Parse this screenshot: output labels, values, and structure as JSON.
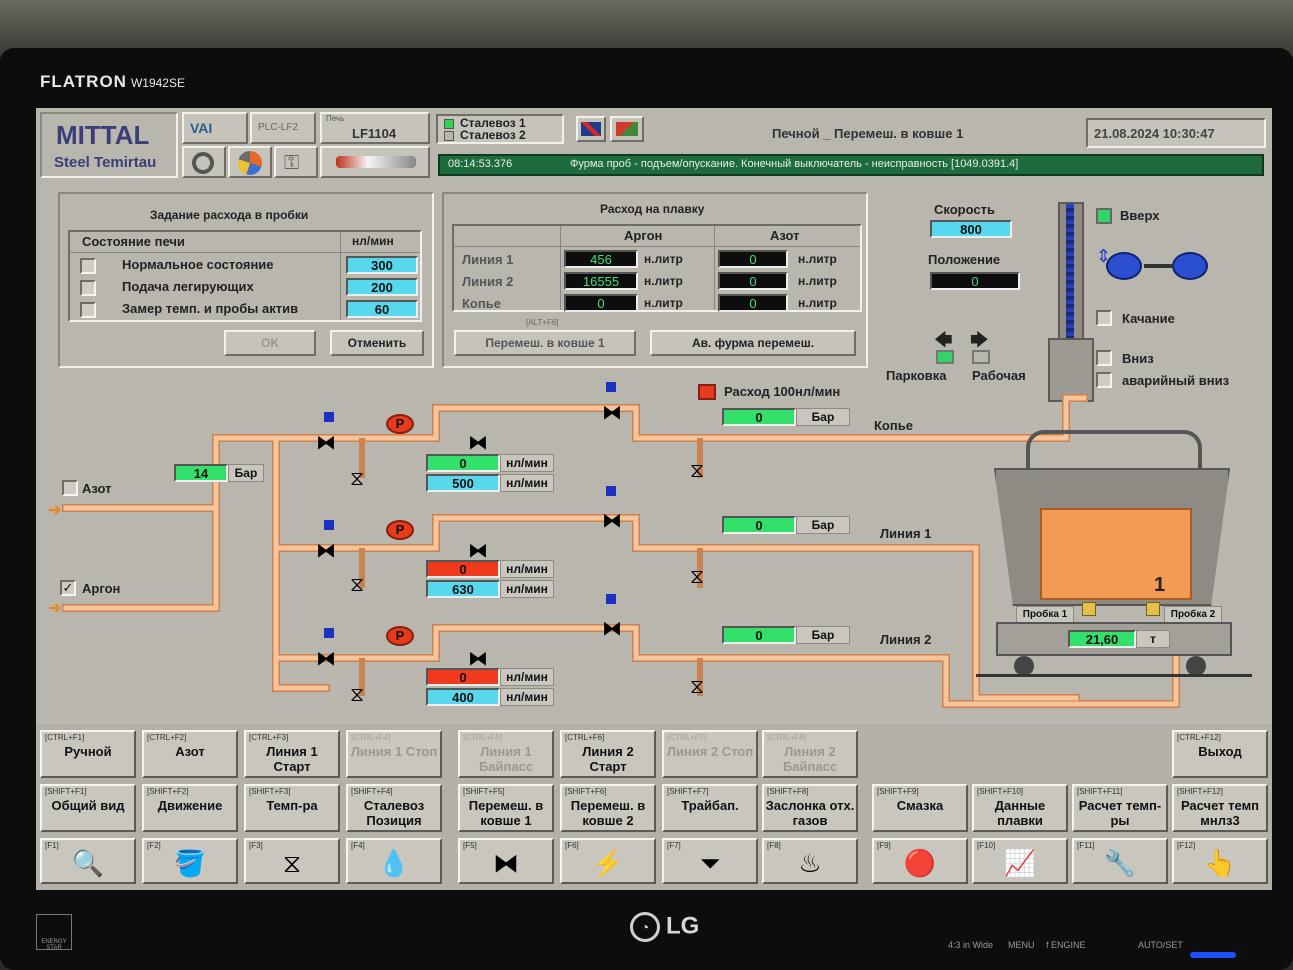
{
  "monitor": {
    "brand": "FLATRON",
    "model": "W1942SE",
    "maker": "LG",
    "buttons": [
      "4:3 in Wide",
      "MENU",
      "f ENGINE",
      "AUTO/SET"
    ]
  },
  "header": {
    "company": "MITTAL",
    "company_sub": "Steel Temirtau",
    "vai_label": "VAI",
    "plc_label": "PLC-LF2",
    "pech_label": "Печь",
    "unit_id": "LF1104",
    "steelcar1": "Сталевоз 1",
    "steelcar2": "Сталевоз 2",
    "mode": "Печной _ Перемеш. в ковше 1",
    "datetime": "21.08.2024 10:30:47",
    "alarm_time": "08:14:53.376",
    "alarm_text": "Фурма проб - подъем/опускание. Конечный выключатель - неисправность [1049.0391.4]"
  },
  "flow_task": {
    "title": "Задание расхода в пробки",
    "col_state": "Состояние печи",
    "col_unit": "нл/мин",
    "rows": [
      {
        "label": "Нормальное состояние",
        "value": "300"
      },
      {
        "label": "Подача легирующих",
        "value": "200"
      },
      {
        "label": "Замер темп. и пробы актив",
        "value": "60"
      }
    ],
    "ok": "OK",
    "cancel": "Отменить"
  },
  "consumption": {
    "title": "Расход на плавку",
    "col_argon": "Аргон",
    "col_nitrogen": "Азот",
    "unit": "н.литр",
    "rows": [
      {
        "label": "Линия 1",
        "argon": "456",
        "nitrogen": "0"
      },
      {
        "label": "Линия 2",
        "argon": "16555",
        "nitrogen": "0"
      },
      {
        "label": "Копье",
        "argon": "0",
        "nitrogen": "0"
      }
    ],
    "hotkey": "[ALT+F6]",
    "btn_stir": "Перемеш. в ковше 1",
    "btn_emergency": "Ав. фурма перемеш."
  },
  "lance": {
    "speed_label": "Скорость",
    "speed": "800",
    "position_label": "Положение",
    "position": "0",
    "up": "Вверх",
    "swing": "Качание",
    "down": "Вниз",
    "emergency_down": "аварийный вниз",
    "parking": "Парковка",
    "working": "Рабочая"
  },
  "process": {
    "nitrogen": "Азот",
    "argon": "Аргон",
    "inlet_pressure": "14",
    "bar": "Бар",
    "flow_unit": "нл/мин",
    "flow100": "Расход 100нл/мин",
    "lance_label": "Копье",
    "line1_label": "Линия 1",
    "line2_label": "Линия 2",
    "lance_pressure": "0",
    "line1_pressure": "0",
    "line2_pressure": "0",
    "lance_flow": "0",
    "lance_setpoint": "500",
    "line1_flow": "0",
    "line1_setpoint": "630",
    "line2_flow": "0",
    "line2_setpoint": "400",
    "p": "P",
    "plug1": "Пробка 1",
    "plug2": "Пробка 2",
    "ladle_no": "1",
    "weight": "21,60",
    "ton": "т"
  },
  "fkeys_row1": [
    {
      "key": "[CTRL+F1]",
      "label": "Ручной",
      "enabled": true
    },
    {
      "key": "[CTRL+F2]",
      "label": "Азот",
      "enabled": true
    },
    {
      "key": "[CTRL+F3]",
      "label": "Линия 1 Старт",
      "enabled": true
    },
    {
      "key": "[CTRL+F4]",
      "label": "Линия 1 Стоп",
      "enabled": false
    },
    {
      "key": "[CTRL+F5]",
      "label": "Линия 1 Байпасс",
      "enabled": false
    },
    {
      "key": "[CTRL+F6]",
      "label": "Линия 2 Старт",
      "enabled": true
    },
    {
      "key": "[CTRL+F7]",
      "label": "Линия 2 Стоп",
      "enabled": false
    },
    {
      "key": "[CTRL+F8]",
      "label": "Линия 2 Байпасс",
      "enabled": false
    },
    {
      "key": "[CTRL+F12]",
      "label": "Выход",
      "enabled": true
    }
  ],
  "fkeys_row2": [
    {
      "key": "[SHIFT+F1]",
      "label": "Общий вид"
    },
    {
      "key": "[SHIFT+F2]",
      "label": "Движение"
    },
    {
      "key": "[SHIFT+F3]",
      "label": "Темп-ра"
    },
    {
      "key": "[SHIFT+F4]",
      "label": "Сталевоз Позиция"
    },
    {
      "key": "[SHIFT+F5]",
      "label": "Перемеш. в ковше 1"
    },
    {
      "key": "[SHIFT+F6]",
      "label": "Перемеш. в ковше 2"
    },
    {
      "key": "[SHIFT+F7]",
      "label": "Трайбап."
    },
    {
      "key": "[SHIFT+F8]",
      "label": "Заслонка отх. газов"
    },
    {
      "key": "[SHIFT+F9]",
      "label": "Смазка"
    },
    {
      "key": "[SHIFT+F10]",
      "label": "Данные плавки"
    },
    {
      "key": "[SHIFT+F11]",
      "label": "Расчет темп-ры"
    },
    {
      "key": "[SHIFT+F12]",
      "label": "Расчет темп мнлз3"
    }
  ],
  "fkeys_row3": [
    {
      "key": "[F1]",
      "icon": "magnifier-icon",
      "glyph": "🔍"
    },
    {
      "key": "[F2]",
      "icon": "ladle-icon",
      "glyph": "🪣"
    },
    {
      "key": "[F3]",
      "icon": "valve-icon",
      "glyph": "⧖"
    },
    {
      "key": "[F4]",
      "icon": "drops-icon",
      "glyph": "💧"
    },
    {
      "key": "[F5]",
      "icon": "cylinder-icon",
      "glyph": "⧓"
    },
    {
      "key": "[F6]",
      "icon": "lightning-icon",
      "glyph": "⚡"
    },
    {
      "key": "[F7]",
      "icon": "wire-feeder-icon",
      "glyph": "⏷"
    },
    {
      "key": "[F8]",
      "icon": "exhaust-icon",
      "glyph": "♨"
    },
    {
      "key": "[F9]",
      "icon": "alarm-bell-icon",
      "glyph": "🔴"
    },
    {
      "key": "[F10]",
      "icon": "trend-chart-icon",
      "glyph": "📈"
    },
    {
      "key": "[F11]",
      "icon": "wrench-icon",
      "glyph": "🔧"
    },
    {
      "key": "[F12]",
      "icon": "operator-icon",
      "glyph": "👆"
    }
  ],
  "colors": {
    "pipe": "#f4b27a",
    "pipe_edge": "#c98250",
    "steel": "#f39b55",
    "screen": "#b9b6ae"
  }
}
